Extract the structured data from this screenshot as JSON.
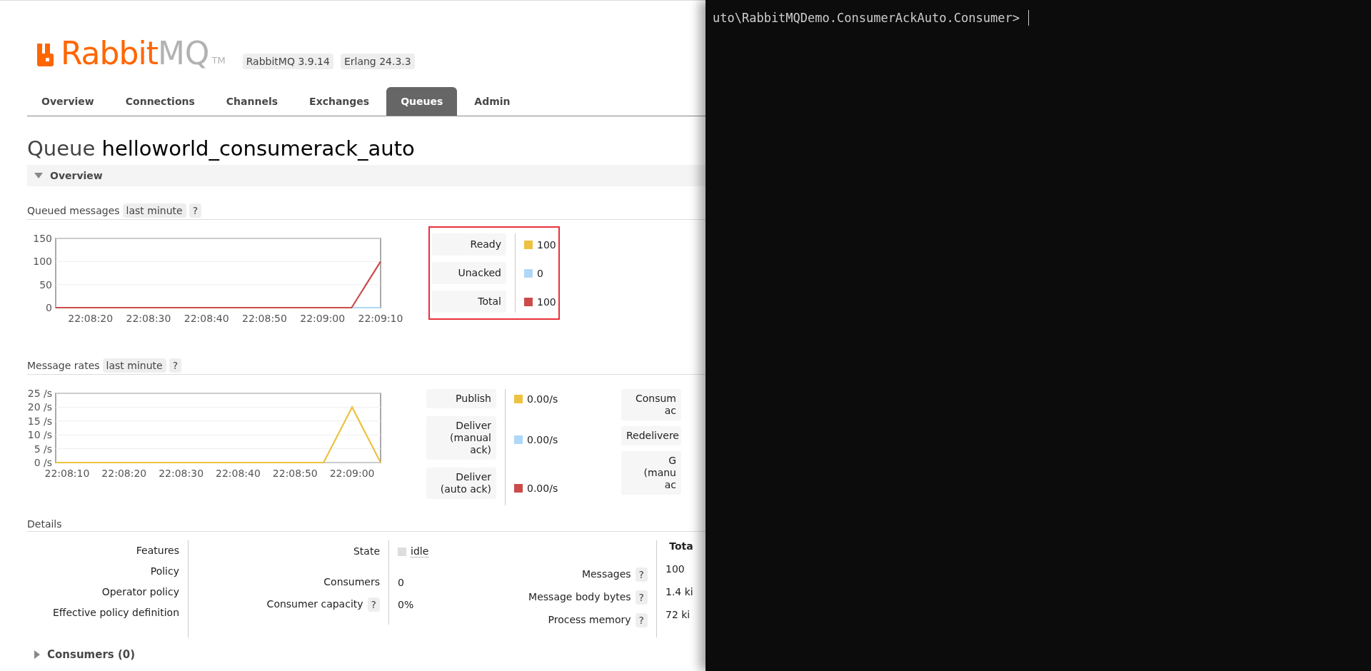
{
  "header": {
    "logo": {
      "primary": "Rabbit",
      "secondary": "MQ",
      "mark": "TM"
    },
    "versions": [
      "RabbitMQ 3.9.14",
      "Erlang 24.3.3"
    ]
  },
  "tabs": [
    {
      "label": "Overview",
      "selected": false
    },
    {
      "label": "Connections",
      "selected": false
    },
    {
      "label": "Channels",
      "selected": false
    },
    {
      "label": "Exchanges",
      "selected": false
    },
    {
      "label": "Queues",
      "selected": true
    },
    {
      "label": "Admin",
      "selected": false
    }
  ],
  "title": {
    "kind_label": "Queue",
    "name": "helloworld_consumerack_auto"
  },
  "overview_section": {
    "label": "Overview",
    "expanded": true
  },
  "queued_messages": {
    "label": "Queued messages",
    "range": "last minute",
    "help": "?",
    "chart_data": {
      "type": "line",
      "x": [
        79694,
        79745,
        79750
      ],
      "xlim": [
        79694,
        79750
      ],
      "ylim": [
        0,
        150
      ],
      "yticks": [
        0,
        50,
        100,
        150
      ],
      "xticks": [
        {
          "value": 79700,
          "label": "22:08:20"
        },
        {
          "value": 79710,
          "label": "22:08:30"
        },
        {
          "value": 79720,
          "label": "22:08:40"
        },
        {
          "value": 79730,
          "label": "22:08:50"
        },
        {
          "value": 79740,
          "label": "22:09:00"
        },
        {
          "value": 79750,
          "label": "22:09:10"
        }
      ],
      "grid": true,
      "series": [
        {
          "name": "Ready",
          "color": "#edc240",
          "values": [
            null,
            null,
            null
          ]
        },
        {
          "name": "Unacked",
          "color": "#afd8f8",
          "values": [
            null,
            0,
            0
          ]
        },
        {
          "name": "Total",
          "color": "#cb4b4b",
          "values": [
            0,
            0,
            100
          ]
        }
      ]
    },
    "legend": {
      "highlighted": true,
      "values": [
        "100",
        "0",
        "100"
      ]
    }
  },
  "message_rates": {
    "label": "Message rates",
    "range": "last minute",
    "help": "?",
    "chart_data": {
      "type": "line",
      "x": [
        79688,
        79735,
        79740,
        79745
      ],
      "xlim": [
        79688,
        79745
      ],
      "ylim": [
        0,
        25
      ],
      "yticks": [
        {
          "value": 0,
          "label": "0 /s"
        },
        {
          "value": 5,
          "label": "5 /s"
        },
        {
          "value": 10,
          "label": "10 /s"
        },
        {
          "value": 15,
          "label": "15 /s"
        },
        {
          "value": 20,
          "label": "20 /s"
        },
        {
          "value": 25,
          "label": "25 /s"
        }
      ],
      "xticks": [
        {
          "value": 79690,
          "label": "22:08:10"
        },
        {
          "value": 79700,
          "label": "22:08:20"
        },
        {
          "value": 79710,
          "label": "22:08:30"
        },
        {
          "value": 79720,
          "label": "22:08:40"
        },
        {
          "value": 79730,
          "label": "22:08:50"
        },
        {
          "value": 79740,
          "label": "22:09:00"
        }
      ],
      "series": [
        {
          "name": "Publish",
          "color": "#edc240",
          "values": [
            0,
            0,
            20,
            0
          ]
        },
        {
          "name": "Deliver (manual ack)",
          "color": "#afd8f8",
          "values": [
            null,
            null,
            null,
            null
          ]
        },
        {
          "name": "Deliver (auto ack)",
          "color": "#cb4b4b",
          "values": [
            null,
            null,
            null,
            null
          ]
        }
      ],
      "grid": true
    },
    "legend_values": [
      "0.00/s",
      "0.00/s",
      "0.00/s"
    ],
    "legend_cut": [
      "Consum\nac",
      "Redelivere",
      "G\n(manu\nac"
    ]
  },
  "details": {
    "label": "Details",
    "policy_labels": [
      "Features",
      "Policy",
      "Operator policy",
      "Effective policy definition"
    ],
    "state": {
      "label": "State",
      "value": "idle"
    },
    "consumers": {
      "label": "Consumers",
      "value": "0"
    },
    "capacity": {
      "label": "Consumer capacity",
      "help": "?",
      "value": "0%"
    },
    "totals_header": "Tota",
    "totals": [
      {
        "label": "Messages",
        "help": "?",
        "value": "100"
      },
      {
        "label": "Message body bytes",
        "help": "?",
        "value": "1.4 ki"
      },
      {
        "label": "Process memory",
        "help": "?",
        "value": "72 ki"
      }
    ]
  },
  "consumers_section": {
    "label": "Consumers (0)",
    "expanded": false
  },
  "terminal": {
    "lines": [
      "uto\\RabbitMQDemo.ConsumerAckAuto.Consumer>"
    ]
  }
}
